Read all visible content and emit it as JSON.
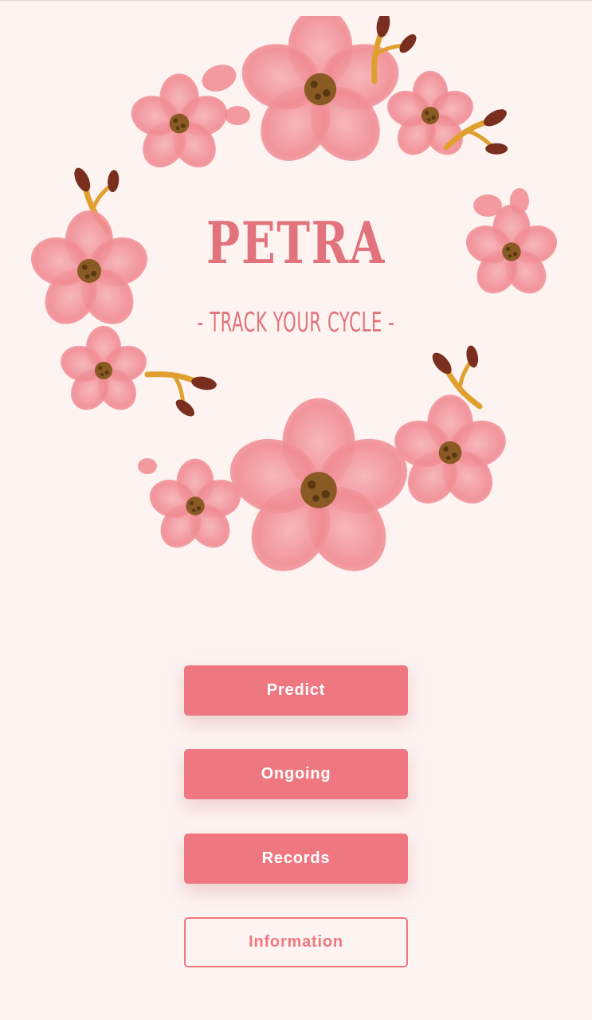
{
  "app": {
    "title": "PETRA",
    "subtitle": "- TRACK YOUR CYCLE -"
  },
  "wreath": {
    "icon": "flower-wreath-icon",
    "petal_color": "#f08a92",
    "petal_light_color": "#f6b1b5",
    "center_color": "#8a5a24",
    "branch_color": "#e0a030",
    "bud_color": "#7a2f1e"
  },
  "buttons": {
    "predict": "Predict",
    "ongoing": "Ongoing",
    "records": "Records",
    "information": "Information"
  },
  "colors": {
    "background": "#fdf3f1",
    "accent": "#ef7880",
    "title": "#e2727b"
  }
}
